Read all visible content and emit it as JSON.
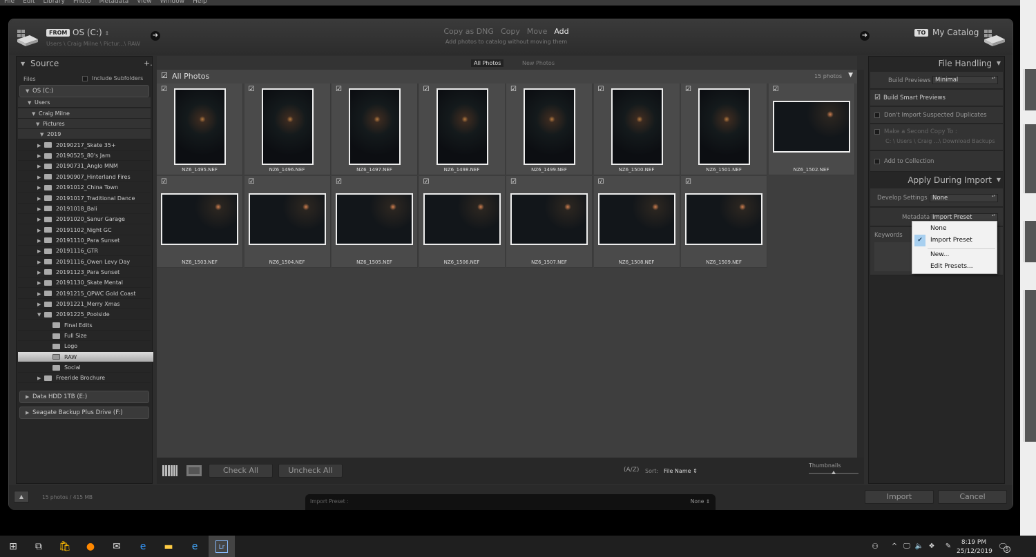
{
  "menubar": [
    "File",
    "Edit",
    "Library",
    "Photo",
    "Metadata",
    "View",
    "Window",
    "Help"
  ],
  "header": {
    "from_tag": "FROM",
    "source": "OS (C:)",
    "source_path": "Users \\ Craig Milne \\ Pictur...\\ RAW",
    "modes": [
      "Copy as DNG",
      "Copy",
      "Move",
      "Add"
    ],
    "active_mode": "Add",
    "mode_desc": "Add photos to catalog without moving them",
    "to_tag": "TO",
    "destination": "My Catalog"
  },
  "source": {
    "title": "Source",
    "add": "+.",
    "files_label": "Files",
    "include_subfolders": "Include Subfolders",
    "include_subfolders_checked": false,
    "tree": [
      {
        "label": "OS (C:)",
        "level": 0,
        "expanded": true,
        "type": "drive"
      },
      {
        "label": "Users",
        "level": 1,
        "expanded": true
      },
      {
        "label": "Craig Milne",
        "level": 2,
        "expanded": true
      },
      {
        "label": "Pictures",
        "level": 3,
        "expanded": true
      },
      {
        "label": "2019",
        "level": 4,
        "expanded": true
      },
      {
        "label": "20190217_Skate 35+",
        "level": 5
      },
      {
        "label": "20190525_80's Jam",
        "level": 5
      },
      {
        "label": "20190731_Anglo MNM",
        "level": 5
      },
      {
        "label": "20190907_Hinterland Fires",
        "level": 5
      },
      {
        "label": "20191012_China Town",
        "level": 5
      },
      {
        "label": "20191017_Traditional Dance",
        "level": 5
      },
      {
        "label": "20191018_Bali",
        "level": 5
      },
      {
        "label": "20191020_Sanur Garage",
        "level": 5
      },
      {
        "label": "20191102_Night GC",
        "level": 5
      },
      {
        "label": "20191110_Para Sunset",
        "level": 5
      },
      {
        "label": "20191116_GTR",
        "level": 5
      },
      {
        "label": "20191116_Owen Levy Day",
        "level": 5
      },
      {
        "label": "20191123_Para Sunset",
        "level": 5
      },
      {
        "label": "20191130_Skate Mental",
        "level": 5
      },
      {
        "label": "20191215_QPWC Gold Coast",
        "level": 5
      },
      {
        "label": "20191221_Merry Xmas",
        "level": 5
      },
      {
        "label": "20191225_Poolside",
        "level": 5,
        "expanded": true
      },
      {
        "label": "Final Edits",
        "level": 6
      },
      {
        "label": "Full Size",
        "level": 6
      },
      {
        "label": "Logo",
        "level": 6
      },
      {
        "label": "RAW",
        "level": 6,
        "selected": true
      },
      {
        "label": "Social",
        "level": 6
      },
      {
        "label": "Freeride Brochure",
        "level": 5
      }
    ],
    "drives": [
      "Data HDD 1TB (E:)",
      "Seagate Backup Plus Drive (F:)"
    ]
  },
  "center": {
    "tabs": [
      "All Photos",
      "New Photos"
    ],
    "active_tab": "All Photos",
    "all_photos": "All Photos",
    "count": "15 photos",
    "photos": [
      {
        "name": "NZ6_1495.NEF",
        "orientation": "portrait",
        "checked": true
      },
      {
        "name": "NZ6_1496.NEF",
        "orientation": "portrait",
        "checked": true
      },
      {
        "name": "NZ6_1497.NEF",
        "orientation": "portrait",
        "checked": true
      },
      {
        "name": "NZ6_1498.NEF",
        "orientation": "portrait",
        "checked": true
      },
      {
        "name": "NZ6_1499.NEF",
        "orientation": "portrait",
        "checked": true
      },
      {
        "name": "NZ6_1500.NEF",
        "orientation": "portrait",
        "checked": true
      },
      {
        "name": "NZ6_1501.NEF",
        "orientation": "portrait",
        "checked": true
      },
      {
        "name": "NZ6_1502.NEF",
        "orientation": "landscape",
        "checked": true
      },
      {
        "name": "NZ6_1503.NEF",
        "orientation": "landscape",
        "checked": true
      },
      {
        "name": "NZ6_1504.NEF",
        "orientation": "landscape",
        "checked": true
      },
      {
        "name": "NZ6_1505.NEF",
        "orientation": "landscape",
        "checked": true
      },
      {
        "name": "NZ6_1506.NEF",
        "orientation": "landscape",
        "checked": true
      },
      {
        "name": "NZ6_1507.NEF",
        "orientation": "landscape",
        "checked": true
      },
      {
        "name": "NZ6_1508.NEF",
        "orientation": "landscape",
        "checked": true
      },
      {
        "name": "NZ6_1509.NEF",
        "orientation": "landscape",
        "checked": true
      }
    ],
    "check_all": "Check All",
    "uncheck_all": "Uncheck All",
    "sort_label": "Sort:",
    "sort_value": "File Name",
    "thumbnails_label": "Thumbnails",
    "thumbnail_size": 0.5
  },
  "right": {
    "file_handling": "File Handling",
    "build_previews_label": "Build Previews",
    "build_previews_value": "Minimal",
    "build_smart_previews": "Build Smart Previews",
    "build_smart_previews_checked": true,
    "dont_import_dupes": "Don't Import Suspected Duplicates",
    "second_copy": "Make a Second Copy To :",
    "second_copy_path": "C: \\ Users \\ Craig ...\\ Download Backups",
    "add_to_collection": "Add to Collection",
    "apply_during_import": "Apply During Import",
    "develop_label": "Develop Settings",
    "develop_value": "None",
    "metadata_label": "Metadata",
    "metadata_value": "Import Preset",
    "keywords_label": "Keywords",
    "dropdown": [
      "None",
      "Import Preset",
      "New...",
      "Edit Presets..."
    ],
    "dropdown_selected": "Import Preset"
  },
  "footer": {
    "summary": "15 photos / 415 MB",
    "import_preset_label": "Import Preset :",
    "import_preset_value": "None",
    "import": "Import",
    "cancel": "Cancel"
  },
  "taskbar": {
    "time": "8:19 PM",
    "date": "25/12/2019",
    "notifications": "5"
  }
}
